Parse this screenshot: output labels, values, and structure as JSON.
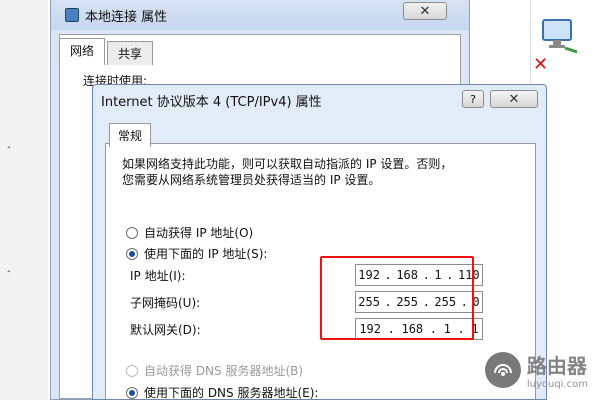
{
  "back_window": {
    "title": "本地连接 属性",
    "tabs": [
      "网络",
      "共享"
    ],
    "partial_label": "连接时使用:"
  },
  "dialog": {
    "title": "Internet 协议版本 4 (TCP/IPv4) 属性",
    "help": "?",
    "close": "✕",
    "tab": "常规",
    "description_line1": "如果网络支持此功能，则可以获取自动指派的 IP 设置。否则，",
    "description_line2": "您需要从网络系统管理员处获得适当的 IP 设置。",
    "auto_ip_label": "自动获得 IP 地址(O)",
    "manual_ip_label": "使用下面的 IP 地址(S):",
    "fields": [
      {
        "label": "IP 地址(I):",
        "octets": [
          "192",
          "168",
          "1",
          "110"
        ]
      },
      {
        "label": "子网掩码(U):",
        "octets": [
          "255",
          "255",
          "255",
          "0"
        ]
      },
      {
        "label": "默认网关(D):",
        "octets": [
          "192",
          "168",
          "1",
          "1"
        ]
      }
    ],
    "auto_dns_label": "自动获得 DNS 服务器地址(B)",
    "manual_dns_label": "使用下面的 DNS 服务器地址(E):"
  },
  "watermark": {
    "text": "路由器",
    "sub": "luyouqi.com"
  },
  "colors": {
    "highlight": "#ee1111",
    "title_bar": "#dbe6f4",
    "radio_selected": "#1b4fa0"
  }
}
